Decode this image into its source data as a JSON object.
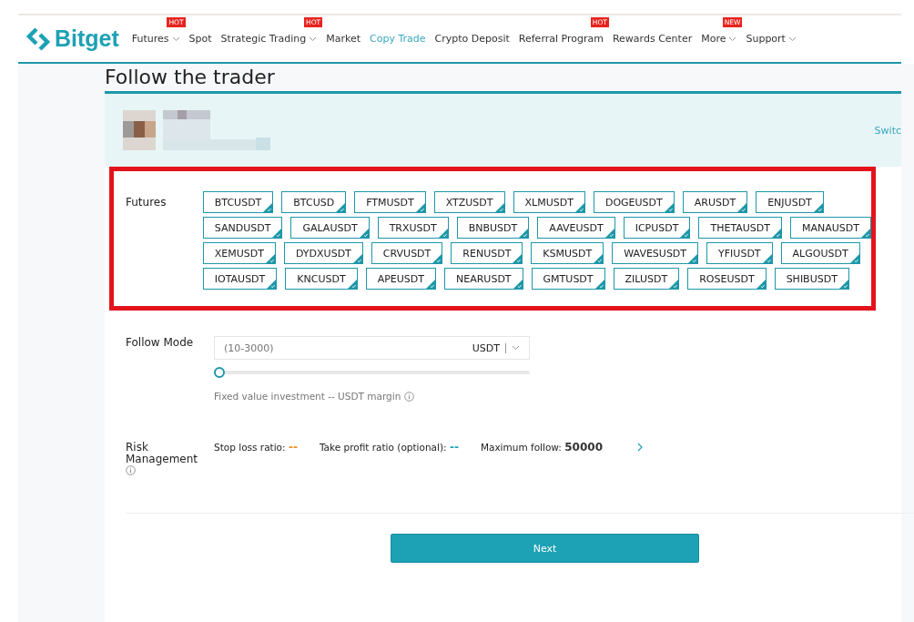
{
  "nav": {
    "logo": "Bitget",
    "items": [
      {
        "label": "Futures",
        "badge": "HOT",
        "dropdown": true,
        "selected": false
      },
      {
        "label": "Spot",
        "dropdown": false,
        "selected": false
      },
      {
        "label": "Strategic Trading",
        "badge": "HOT",
        "dropdown": true,
        "selected": false
      },
      {
        "label": "Market",
        "dropdown": false,
        "selected": false
      },
      {
        "label": "Copy Trade",
        "dropdown": false,
        "selected": true
      },
      {
        "label": "Crypto Deposit",
        "dropdown": false,
        "selected": false
      },
      {
        "label": "Referral Program",
        "badge": "HOT",
        "dropdown": false,
        "selected": false
      },
      {
        "label": "Rewards Center",
        "dropdown": false,
        "selected": false
      },
      {
        "label": "More",
        "badge": "NEW",
        "dropdown": true,
        "selected": false
      },
      {
        "label": "Support",
        "dropdown": true,
        "selected": false
      }
    ]
  },
  "page_title": "Follow the trader",
  "trader": {
    "switch_link": "Switc"
  },
  "futures": {
    "label": "Futures",
    "pairs": [
      {
        "label": "BTCUSDT",
        "selected": true
      },
      {
        "label": "BTCUSD",
        "selected": true
      },
      {
        "label": "FTMUSDT",
        "selected": true
      },
      {
        "label": "XTZUSDT",
        "selected": true
      },
      {
        "label": "XLMUSDT",
        "selected": true
      },
      {
        "label": "DOGEUSDT",
        "selected": true
      },
      {
        "label": "ARUSDT",
        "selected": true
      },
      {
        "label": "ENJUSDT",
        "selected": true
      },
      {
        "label": "SANDUSDT",
        "selected": true
      },
      {
        "label": "GALAUSDT",
        "selected": true
      },
      {
        "label": "TRXUSDT",
        "selected": true
      },
      {
        "label": "BNBUSDT",
        "selected": true
      },
      {
        "label": "AAVEUSDT",
        "selected": true
      },
      {
        "label": "ICPUSDT",
        "selected": true
      },
      {
        "label": "THETAUSDT",
        "selected": true
      },
      {
        "label": "MANAUSDT",
        "selected": true
      },
      {
        "label": "XEMUSDT",
        "selected": true
      },
      {
        "label": "DYDXUSDT",
        "selected": true
      },
      {
        "label": "CRVUSDT",
        "selected": true
      },
      {
        "label": "RENUSDT",
        "selected": true
      },
      {
        "label": "KSMUSDT",
        "selected": true
      },
      {
        "label": "WAVESUSDT",
        "selected": true
      },
      {
        "label": "YFIUSDT",
        "selected": true
      },
      {
        "label": "ALGOUSDT",
        "selected": true
      },
      {
        "label": "IOTAUSDT",
        "selected": true
      },
      {
        "label": "KNCUSDT",
        "selected": true
      },
      {
        "label": "APEUSDT",
        "selected": true
      },
      {
        "label": "NEARUSDT",
        "selected": true
      },
      {
        "label": "GMTUSDT",
        "selected": true
      },
      {
        "label": "ZILUSDT",
        "selected": true
      },
      {
        "label": "ROSEUSDT",
        "selected": true
      },
      {
        "label": "SHIBUSDT",
        "selected": true
      }
    ]
  },
  "follow_mode": {
    "label": "Follow Mode",
    "placeholder": "(10-3000)",
    "unit": "USDT",
    "slider": {
      "level": 0
    },
    "hint": "Fixed value investment -- USDT margin"
  },
  "risk": {
    "label": "Risk Management",
    "items": [
      {
        "label": "Stop loss ratio:",
        "value": "--",
        "color": "#f08a24"
      },
      {
        "label": "Take profit ratio (optional):",
        "value": "--",
        "color": "#1da1b4"
      },
      {
        "label": "Maximum follow:",
        "value": "50000",
        "color": "#333333"
      }
    ]
  },
  "next_button": "Next"
}
